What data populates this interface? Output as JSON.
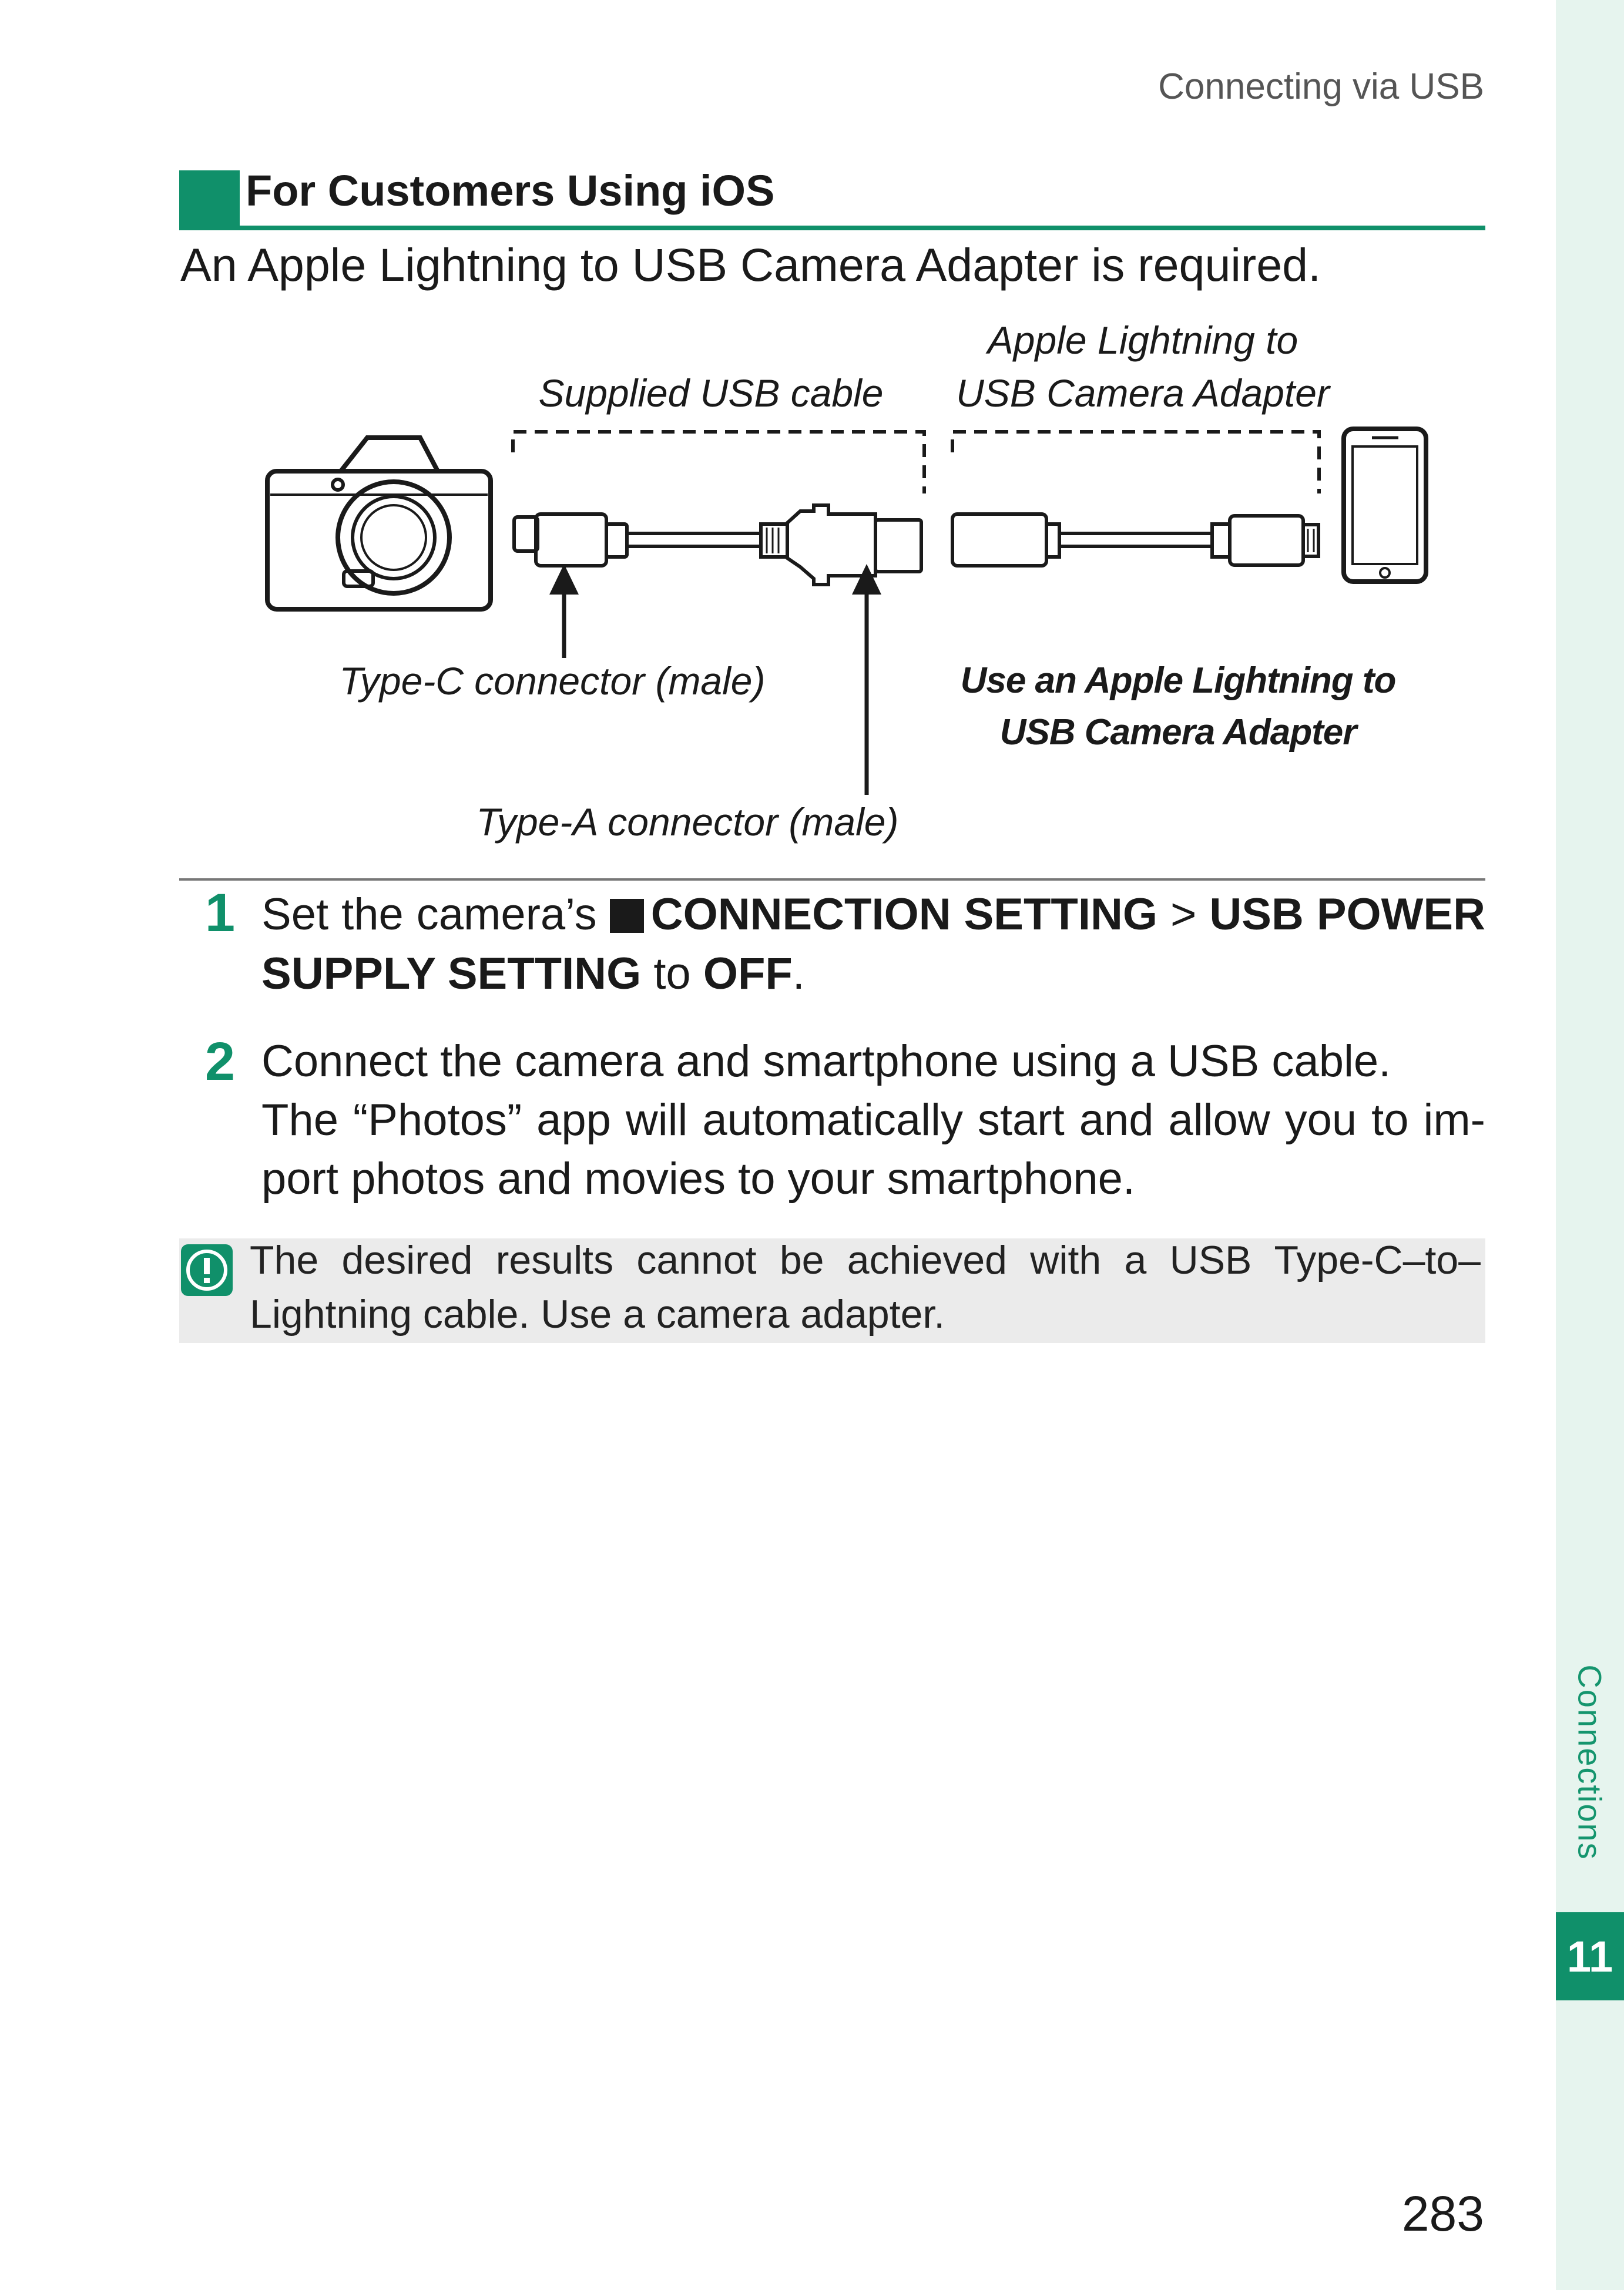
{
  "header": {
    "running_head": "Connecting via USB"
  },
  "section": {
    "title": "For Customers Using iOS"
  },
  "intro": "An Apple Lightning to USB Camera Adapter is required.",
  "diagram": {
    "label_cable": "Supplied USB cable",
    "label_adapter_line1": "Apple Lightning to",
    "label_adapter_line2": "USB Camera Adapter",
    "label_typec": "Type-C connector (male)",
    "label_typea": "Type-A connector (male)",
    "label_use_line1": "Use an Apple Lightning to",
    "label_use_line2": "USB Camera Adapter"
  },
  "steps": [
    {
      "number": "1",
      "line1_pre": "Set the camera’s",
      "line1_bold1": "CONNECTION SETTING",
      "line1_sep": ">",
      "line1_bold2": "USB POWER",
      "line2_bold": "SUPPLY SETTING",
      "line2_mid": "to",
      "line2_bold2": "OFF",
      "line2_end": "."
    },
    {
      "number": "2",
      "line1": "Connect the camera and smartphone using a USB cable.",
      "line2": "The “Photos” app will automatically start and allow you to im-",
      "line3": "port photos and movies to your smartphone."
    }
  ],
  "note": {
    "line1": "The desired results cannot be achieved with a USB Type-C–to–",
    "line2": "Lightning cable. Use a camera adapter."
  },
  "side": {
    "section_label": "Connections",
    "chapter": "11"
  },
  "footer": {
    "page_number": "283"
  },
  "colors": {
    "accent": "#10906a",
    "side_strip": "#e6f4ee",
    "note_bg": "#ebebeb"
  }
}
